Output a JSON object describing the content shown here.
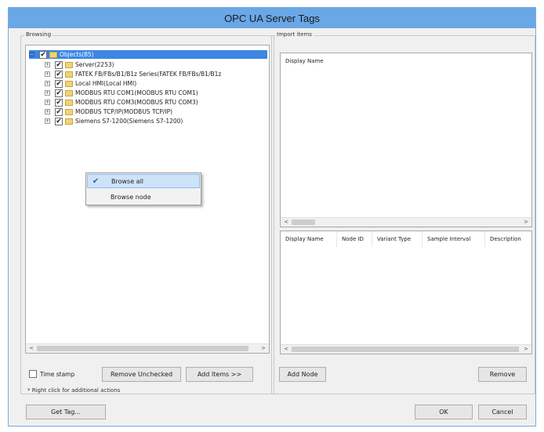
{
  "window": {
    "title": "OPC UA Server Tags"
  },
  "browsing": {
    "label": "Browsing",
    "root": {
      "label": "Objects(85)",
      "expander": "−",
      "checked": "✔"
    },
    "items": [
      {
        "label": "Server(2253)",
        "expander": "+",
        "checked": "✔"
      },
      {
        "label": "FATEK FB/FBs/B1/B1z Series(FATEK FB/FBs/B1/B1z",
        "expander": "+",
        "checked": "✔"
      },
      {
        "label": "Local HMI(Local HMI)",
        "expander": "+",
        "checked": "✔"
      },
      {
        "label": "MODBUS RTU COM1(MODBUS RTU COM1)",
        "expander": "+",
        "checked": "✔"
      },
      {
        "label": "MODBUS RTU COM3(MODBUS RTU COM3)",
        "expander": "+",
        "checked": "✔"
      },
      {
        "label": "MODBUS TCP/IP(MODBUS TCP/IP)",
        "expander": "+",
        "checked": "✔"
      },
      {
        "label": "Siemens S7-1200(Siemens S7-1200)",
        "expander": "+",
        "checked": "✔"
      }
    ],
    "context_menu": {
      "items": [
        {
          "label": "Browse all",
          "check": "✔"
        },
        {
          "label": "Browse node",
          "check": ""
        }
      ]
    },
    "time_stamp_label": "Time stamp",
    "remove_unchecked_label": "Remove Unchecked",
    "add_items_label": "Add Items >>",
    "note": "* Right click for additional actions"
  },
  "import_items": {
    "label": "Import items",
    "top_header": "Display Name",
    "columns": [
      "Display Name",
      "Node ID",
      "Variant Type",
      "Sample Interval",
      "Description"
    ],
    "add_node_label": "Add Node",
    "remove_label": "Remove"
  },
  "footer": {
    "get_tag_label": "Get Tag...",
    "ok_label": "OK",
    "cancel_label": "Cancel"
  },
  "scroll": {
    "left_arrow": "<",
    "right_arrow": ">"
  }
}
